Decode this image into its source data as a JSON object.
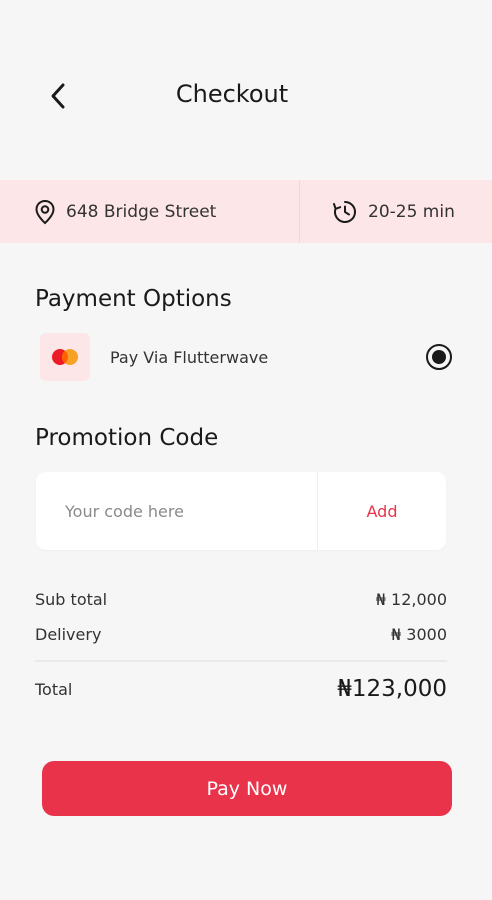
{
  "header": {
    "title": "Checkout",
    "back_icon": "chevron-left-icon"
  },
  "delivery_info": {
    "address": "648 Bridge Street",
    "address_icon": "location-pin-icon",
    "eta": "20-25 min",
    "eta_icon": "clock-history-icon"
  },
  "payment": {
    "section_title": "Payment Options",
    "options": [
      {
        "label": "Pay Via Flutterwave",
        "icon": "mastercard-icon",
        "selected": true
      }
    ]
  },
  "promotion": {
    "section_title": "Promotion Code",
    "placeholder": "Your code here",
    "value": "",
    "add_label": "Add"
  },
  "summary": {
    "subtotal_label": "Sub total",
    "subtotal_value": "₦ 12,000",
    "delivery_label": "Delivery",
    "delivery_value": "₦ 3000",
    "total_label": "Total",
    "total_value": "₦123,000"
  },
  "actions": {
    "pay_now_label": "Pay Now"
  },
  "colors": {
    "accent": "#e8334a",
    "strip_bg": "#fde6e8",
    "page_bg": "#f6f6f6"
  }
}
